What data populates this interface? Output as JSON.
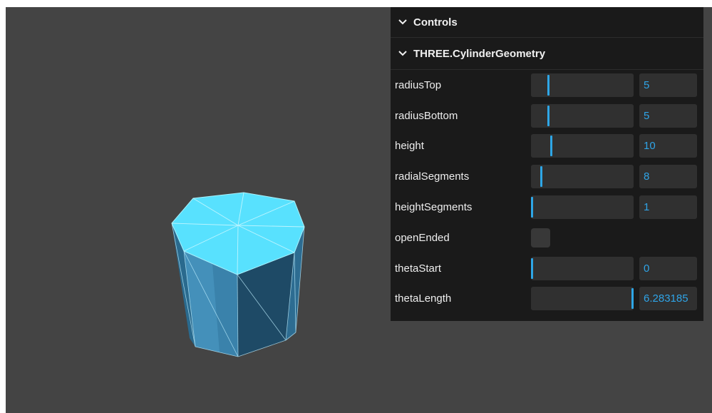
{
  "controls": {
    "title": "Controls",
    "folder": {
      "title": "THREE.CylinderGeometry",
      "params": [
        {
          "key": "radiusTop",
          "label": "radiusTop",
          "value": "5",
          "level": 0.16,
          "type": "slider"
        },
        {
          "key": "radiusBottom",
          "label": "radiusBottom",
          "value": "5",
          "level": 0.16,
          "type": "slider"
        },
        {
          "key": "height",
          "label": "height",
          "value": "10",
          "level": 0.19,
          "type": "slider"
        },
        {
          "key": "radialSegments",
          "label": "radialSegments",
          "value": "8",
          "level": 0.09,
          "type": "slider"
        },
        {
          "key": "heightSegments",
          "label": "heightSegments",
          "value": "1",
          "level": 0.0,
          "type": "slider"
        },
        {
          "key": "openEnded",
          "label": "openEnded",
          "checked": false,
          "type": "checkbox"
        },
        {
          "key": "thetaStart",
          "label": "thetaStart",
          "value": "0",
          "level": 0.0,
          "type": "slider"
        },
        {
          "key": "thetaLength",
          "label": "thetaLength",
          "value": "6.283185",
          "level": 1.0,
          "type": "slider"
        }
      ]
    }
  },
  "icons": {
    "collapse": "chevron-down-icon"
  },
  "colors": {
    "viewport_bg": "#444444",
    "panel_bg": "#1a1a1a",
    "accent": "#2ea6e6",
    "cylinder_top": "#55e2ff",
    "cylinder_side": "#2f6f93"
  }
}
